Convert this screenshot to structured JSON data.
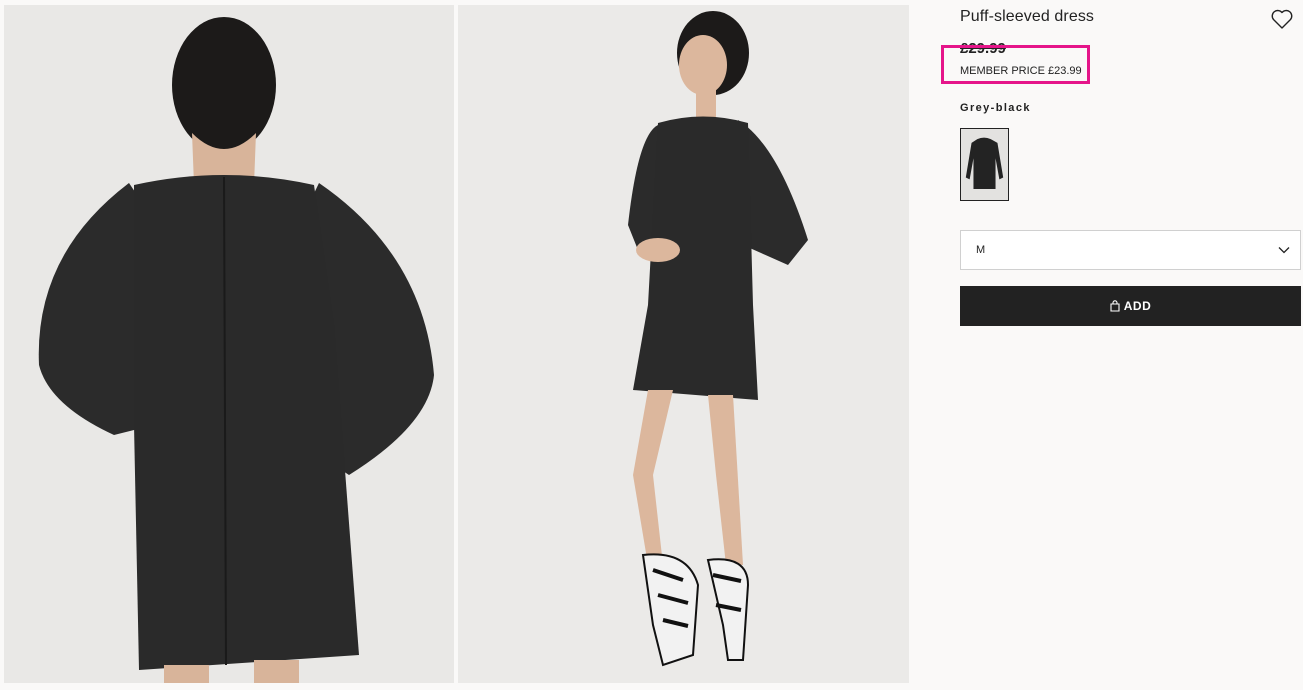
{
  "product": {
    "title": "Puff-sleeved dress",
    "price": "£29.99",
    "member_price": "MEMBER PRICE £23.99",
    "color_label": "Grey-black",
    "selected_size": "M",
    "add_label": "ADD"
  },
  "icons": {
    "favourite": "heart-outline-icon",
    "size_dropdown": "chevron-down-icon",
    "add": "shopping-bag-icon"
  },
  "colors": {
    "highlight": "#e5158a",
    "button_bg": "#222222",
    "page_bg": "#faf9f8"
  }
}
